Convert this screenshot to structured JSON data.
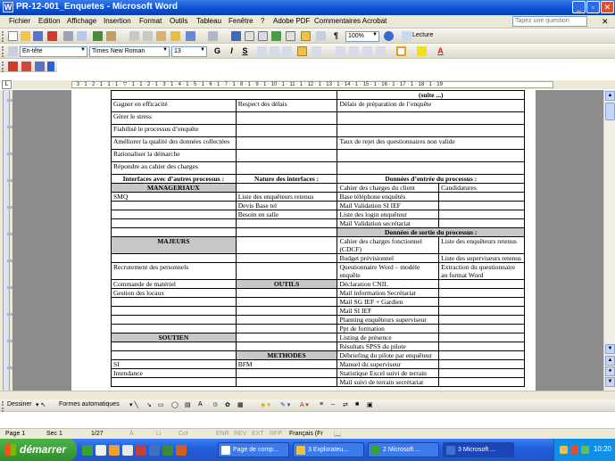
{
  "window": {
    "title": "PR-12-001_Enquetes - Microsoft Word",
    "app_icon": "W"
  },
  "menu": {
    "items": [
      "Fichier",
      "Edition",
      "Affichage",
      "Insertion",
      "Format",
      "Outils",
      "Tableau",
      "Fenêtre",
      "?",
      "Adobe PDF",
      "Commentaires Acrobat"
    ],
    "ask_placeholder": "Tapez une question"
  },
  "standard_toolbar": {
    "zoom": "100%",
    "read_label": "Lecture"
  },
  "format_toolbar": {
    "style": "En-tête",
    "font": "Times New Roman",
    "size": "13"
  },
  "ruler": {
    "numbers": "· 3 · 1 · 2 · 1 · 1 · 1 · ▽ · 1 · 1 · 2 · 1 · 3 · 1 · 4 · 1 · 5 · 1 · 6 · 1 · 7 · 1 · 8 · 1 · 9 · 1 · 10 · 1 · 11 · 1 · 12 · 1 · 13 · 1 · 14 · 1 · 15 · 1 · 16 · 1 · 17 · 1 · 18 · 1 · 19"
  },
  "document": {
    "top_partial": "(suite ...)",
    "objectives": [
      [
        "Gagner en efficacité",
        "Respect des délais",
        "Délais de préparation de l’enquête"
      ],
      [
        "Gérer le stress",
        "",
        ""
      ],
      [
        "Fiabilisé le processus d’enquête",
        "",
        ""
      ],
      [
        "Améliorer la qualité des données collectées",
        "",
        "Taux de rejet des questionnaires non valide"
      ],
      [
        "Rationaliser la démarche",
        "",
        ""
      ],
      [
        "Répondre au cahier des charges",
        "",
        ""
      ]
    ],
    "headers": {
      "interfaces": "Interfaces avec d’autres processus :",
      "nature": "Nature des interfaces :",
      "inputs": "Données d’entrée du processus :",
      "outputs": "Données de sortie du processus :"
    },
    "groups": {
      "manageriaux": "MANAGERIAUX",
      "majeurs": "MAJEURS",
      "outils": "OUTILS",
      "soutien": "SOUTIEN",
      "methodes": "METHODES"
    },
    "rows_a": [
      [
        "",
        "",
        "Cahier des charges du client",
        "Candidatures"
      ],
      [
        "SMQ",
        "Liste des enquêteurs retenus",
        "Base téléphone enquêtés",
        ""
      ],
      [
        "",
        "Devis Base tel",
        "Mail Validation SI IEF",
        ""
      ],
      [
        "",
        "Besoin en salle",
        "Liste des login enquêteur",
        ""
      ],
      [
        "",
        "",
        "Mail Validation secrétariat",
        ""
      ]
    ],
    "rows_b": [
      [
        "",
        "",
        "Cahier des charges fonctionnel (CDCF)",
        "Liste des enquêteurs retenus"
      ],
      [
        "",
        "",
        "Budget prévisionnel",
        "Liste des superviseurs retenus"
      ],
      [
        "Recrutement des personnels",
        "",
        "Questionnaire Word – modèle enquête",
        "Extraction du questionnaire au format  Word"
      ],
      [
        "Commande de matériel",
        "",
        "Déclaration CNIL",
        ""
      ],
      [
        "Gestion des locaux",
        "",
        "Mail information Secrétariat",
        ""
      ],
      [
        "",
        "",
        "Mail SG IEF + Gardien",
        ""
      ],
      [
        "",
        "",
        "Mail SI IEF",
        ""
      ],
      [
        "",
        "",
        "Planning enquêteurs superviseur",
        ""
      ],
      [
        "",
        "",
        "Ppt de formation",
        ""
      ],
      [
        "",
        "",
        "Listing de présence",
        ""
      ],
      [
        "",
        "",
        "Résultats SPSS du pilote",
        ""
      ],
      [
        "",
        "",
        "Débriefing du pilote par enquêteur",
        ""
      ],
      [
        "SI",
        "BFM",
        "Manuel du superviseur",
        ""
      ],
      [
        "Intendance",
        "",
        "Statistique Excel suivi de terrain",
        ""
      ],
      [
        "",
        "",
        "Mail suivi de terrain secrétariat",
        ""
      ]
    ]
  },
  "drawing_toolbar": {
    "draw_label": "Dessiner",
    "autoshapes_label": "Formes automatiques"
  },
  "status": {
    "page": "Page  1",
    "section": "Sec  1",
    "pages": "1/27",
    "at": "À",
    "line": "Li",
    "col": "Col",
    "modes": [
      "ENR",
      "REV",
      "EXT",
      "RFP"
    ],
    "language": "Français (Fr"
  },
  "taskbar": {
    "start_label": "démarrer",
    "tasks": [
      "Page de comp...",
      "3 Explorateu...",
      "2 Microsoft ...",
      "3 Microsoft ..."
    ],
    "clock": "10:20"
  }
}
